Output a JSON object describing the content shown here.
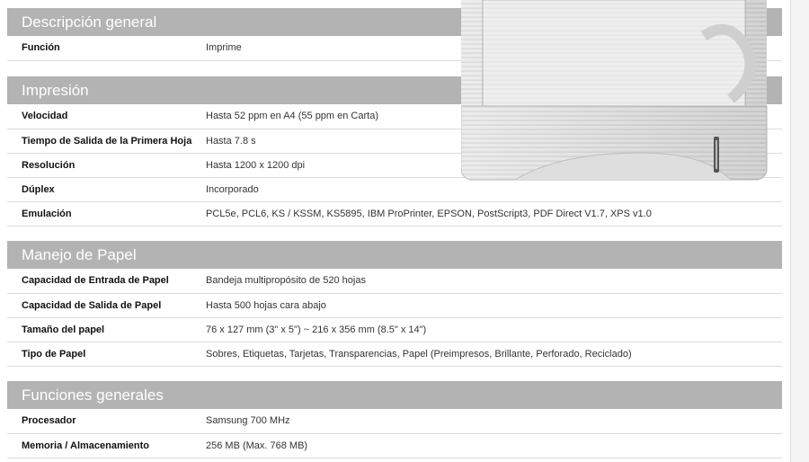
{
  "sections": [
    {
      "title": "Descripción general",
      "rows": [
        {
          "label": "Función",
          "value": "Imprime"
        }
      ]
    },
    {
      "title": "Impresión",
      "rows": [
        {
          "label": "Velocidad",
          "value": "Hasta 52 ppm en A4 (55 ppm en Carta)"
        },
        {
          "label": "Tiempo de Salida de la Primera Hoja",
          "value": "Hasta 7.8 s"
        },
        {
          "label": "Resolución",
          "value": "Hasta 1200 x 1200 dpi"
        },
        {
          "label": "Dúplex",
          "value": "Incorporado"
        },
        {
          "label": "Emulación",
          "value": "PCL5e, PCL6, KS / KSSM, KS5895, IBM ProPrinter, EPSON, PostScript3, PDF Direct V1.7, XPS v1.0"
        }
      ]
    },
    {
      "title": "Manejo de Papel",
      "rows": [
        {
          "label": "Capacidad de Entrada de Papel",
          "value": "Bandeja multipropósito de 520 hojas"
        },
        {
          "label": "Capacidad de Salida de Papel",
          "value": "Hasta 500 hojas cara abajo"
        },
        {
          "label": "Tamaño del papel",
          "value": "76 x 127 mm (3\" x 5\") ~ 216 x 356 mm (8.5\" x 14\")"
        },
        {
          "label": "Tipo de Papel",
          "value": "Sobres, Etiquetas, Tarjetas, Transparencias, Papel (Preimpresos, Brillante, Perforado, Reciclado)"
        }
      ]
    },
    {
      "title": "Funciones generales",
      "rows": [
        {
          "label": "Procesador",
          "value": "Samsung 700 MHz"
        },
        {
          "label": "Memoria / Almacenamiento",
          "value": "256 MB (Max. 768 MB)"
        }
      ]
    }
  ]
}
